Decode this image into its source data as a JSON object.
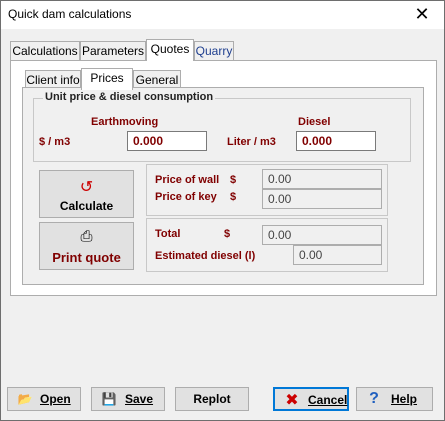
{
  "window": {
    "title": "Quick dam calculations",
    "close": "✕"
  },
  "tabs": [
    "Calculations",
    "Parameters",
    "Quotes",
    "Quarry"
  ],
  "inner_tabs": [
    "Client info",
    "Prices",
    "General"
  ],
  "unit_price": {
    "group_title": "Unit price & diesel consumption",
    "earthmoving_header": "Earthmoving",
    "diesel_header": "Diesel",
    "earthmoving_unit": "$ / m3",
    "earthmoving_value": "0.000",
    "diesel_unit": "Liter / m3",
    "diesel_value": "0.000"
  },
  "buttons": {
    "calculate": "Calculate",
    "print_quote": "Print quote"
  },
  "results": {
    "price_wall_label": "Price of wall",
    "price_wall_currency": "$",
    "price_wall_value": "0.00",
    "price_key_label": "Price of key",
    "price_key_currency": "$",
    "price_key_value": "0.00",
    "total_label": "Total",
    "total_currency": "$",
    "total_value": "0.00",
    "diesel_label": "Estimated diesel (l)",
    "diesel_value": "0.00"
  },
  "footer": {
    "open": "Open",
    "save": "Save",
    "replot": "Replot",
    "cancel": "Cancel",
    "help": "Help"
  },
  "colors": {
    "label_red": "#800000",
    "cancel_icon": "#cc0000",
    "help_icon": "#1f5fbf"
  }
}
